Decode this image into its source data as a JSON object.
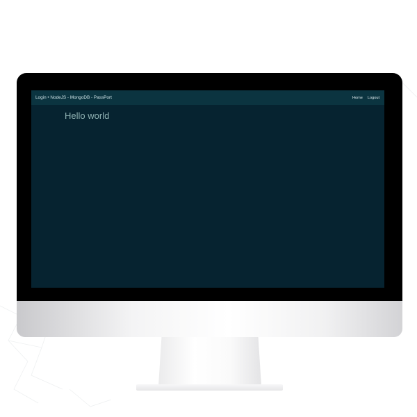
{
  "navbar": {
    "brand": "Login • NodeJS - MongoDB - PassPort",
    "links": [
      {
        "label": "Home"
      },
      {
        "label": "Logout"
      }
    ]
  },
  "main": {
    "heading": "Hello world"
  },
  "colors": {
    "screen_background": "#062330",
    "navbar_background": "#0b3440",
    "heading_text": "#8fb1b2",
    "bezel": "#000000"
  }
}
